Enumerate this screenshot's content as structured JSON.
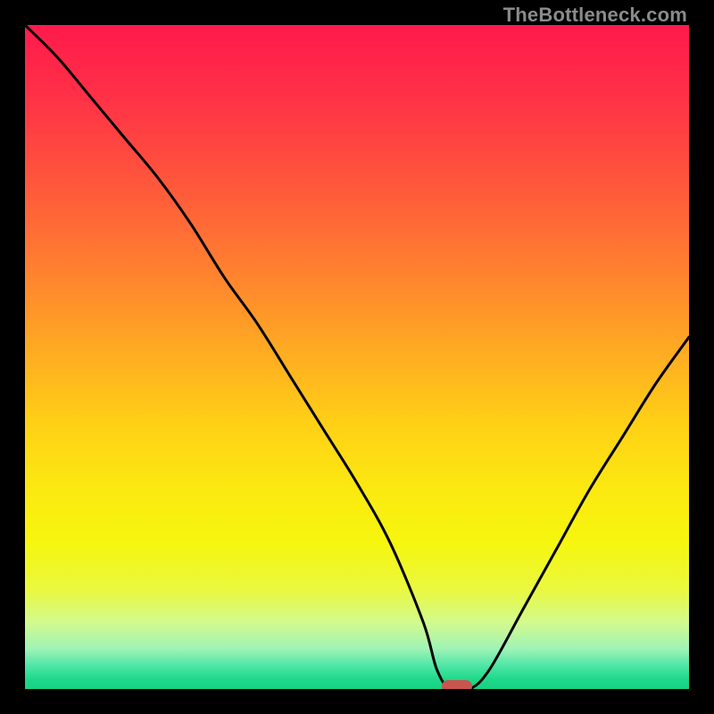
{
  "watermark": "TheBottleneck.com",
  "colors": {
    "background": "#000000",
    "curve_stroke": "#000000",
    "marker_fill": "#c9554f",
    "gradient_stops": [
      {
        "offset": 0.0,
        "color": "#ff1a4c"
      },
      {
        "offset": 0.1,
        "color": "#ff2f47"
      },
      {
        "offset": 0.2,
        "color": "#ff4b3f"
      },
      {
        "offset": 0.3,
        "color": "#ff6a36"
      },
      {
        "offset": 0.4,
        "color": "#ff8b2c"
      },
      {
        "offset": 0.5,
        "color": "#ffae21"
      },
      {
        "offset": 0.6,
        "color": "#ffd016"
      },
      {
        "offset": 0.7,
        "color": "#fbe910"
      },
      {
        "offset": 0.78,
        "color": "#f6f60e"
      },
      {
        "offset": 0.85,
        "color": "#eaf83f"
      },
      {
        "offset": 0.9,
        "color": "#d2fa8e"
      },
      {
        "offset": 0.94,
        "color": "#9ef3b6"
      },
      {
        "offset": 0.965,
        "color": "#4de6a7"
      },
      {
        "offset": 0.985,
        "color": "#1fd98a"
      },
      {
        "offset": 1.0,
        "color": "#17d183"
      }
    ]
  },
  "chart_data": {
    "type": "line",
    "title": "",
    "xlabel": "",
    "ylabel": "",
    "xlim": [
      0,
      100
    ],
    "ylim": [
      0,
      100
    ],
    "x": [
      0,
      5,
      10,
      15,
      20,
      25,
      30,
      35,
      40,
      45,
      50,
      55,
      60,
      62,
      64,
      67,
      70,
      75,
      80,
      85,
      90,
      95,
      100
    ],
    "values": [
      100,
      95,
      89,
      83,
      77,
      70,
      62,
      55,
      47,
      39,
      31,
      22,
      10,
      3,
      0,
      0,
      3,
      12,
      21,
      30,
      38,
      46,
      53
    ],
    "marker": {
      "x": 65,
      "y": 0
    },
    "flat_region_x": [
      64,
      67
    ],
    "inflection_left_x": 30
  }
}
